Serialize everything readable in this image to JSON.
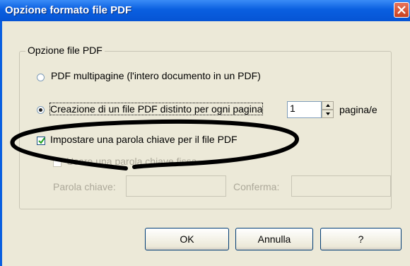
{
  "window": {
    "title": "Opzione formato file PDF"
  },
  "group": {
    "legend": "Opzione file PDF"
  },
  "options": {
    "multipage_label": "PDF multipagine (l'intero documento in un PDF)",
    "separate_label": "Creazione di un file PDF distinto per ogni pagina",
    "pages_value": "1",
    "pages_unit": "pagina/e",
    "keyword_label": "Impostare una parola chiave per il file PDF",
    "fixed_keyword_label": "Usare una parola chiave fissa",
    "keyword_field_label": "Parola chiave:",
    "confirm_field_label": "Conferma:"
  },
  "buttons": {
    "ok": "OK",
    "cancel": "Annulla",
    "help": "?"
  },
  "state": {
    "selected_option": "separate",
    "keyword_checked": true,
    "fixed_keyword_checked": false
  },
  "icons": [
    "close-icon",
    "checkmark-icon",
    "spin-up-icon",
    "spin-down-icon"
  ],
  "colors": {
    "titlebar": "#0a5fe0",
    "dialog_bg": "#ece9d8",
    "annotation": "#000000"
  }
}
